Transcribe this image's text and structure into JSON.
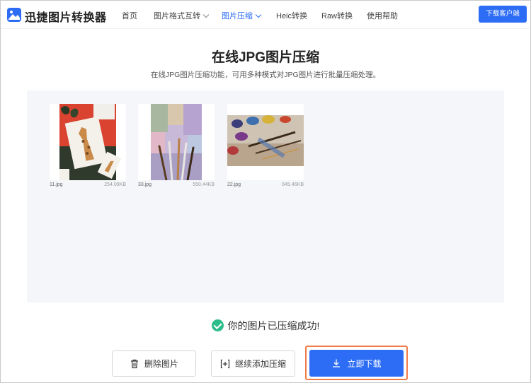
{
  "header": {
    "brand": "迅捷图片转换器",
    "nav": [
      {
        "label": "首页"
      },
      {
        "label": "图片格式互转"
      },
      {
        "label": "图片压缩"
      },
      {
        "label": "Heic转换"
      },
      {
        "label": "Raw转换"
      },
      {
        "label": "使用帮助"
      }
    ],
    "download_client": "下载客户端",
    "active_color": "#2d6df6"
  },
  "main": {
    "title": "在线JPG图片压缩",
    "subtitle": "在线JPG图片压缩功能，可用多种模式对JPG图片进行批量压缩处理。"
  },
  "files": [
    {
      "name": "11.jpg",
      "size": "254.09KB"
    },
    {
      "name": "33.jpg",
      "size": "550.44KB"
    },
    {
      "name": "22.jpg",
      "size": "645.46KB"
    }
  ],
  "status": {
    "message": "你的图片已压缩成功!",
    "color": "#2ebd8a"
  },
  "actions": {
    "delete": "删除图片",
    "continue": "继续添加压缩",
    "download": "立即下载",
    "highlight_color": "#f07c4a"
  }
}
